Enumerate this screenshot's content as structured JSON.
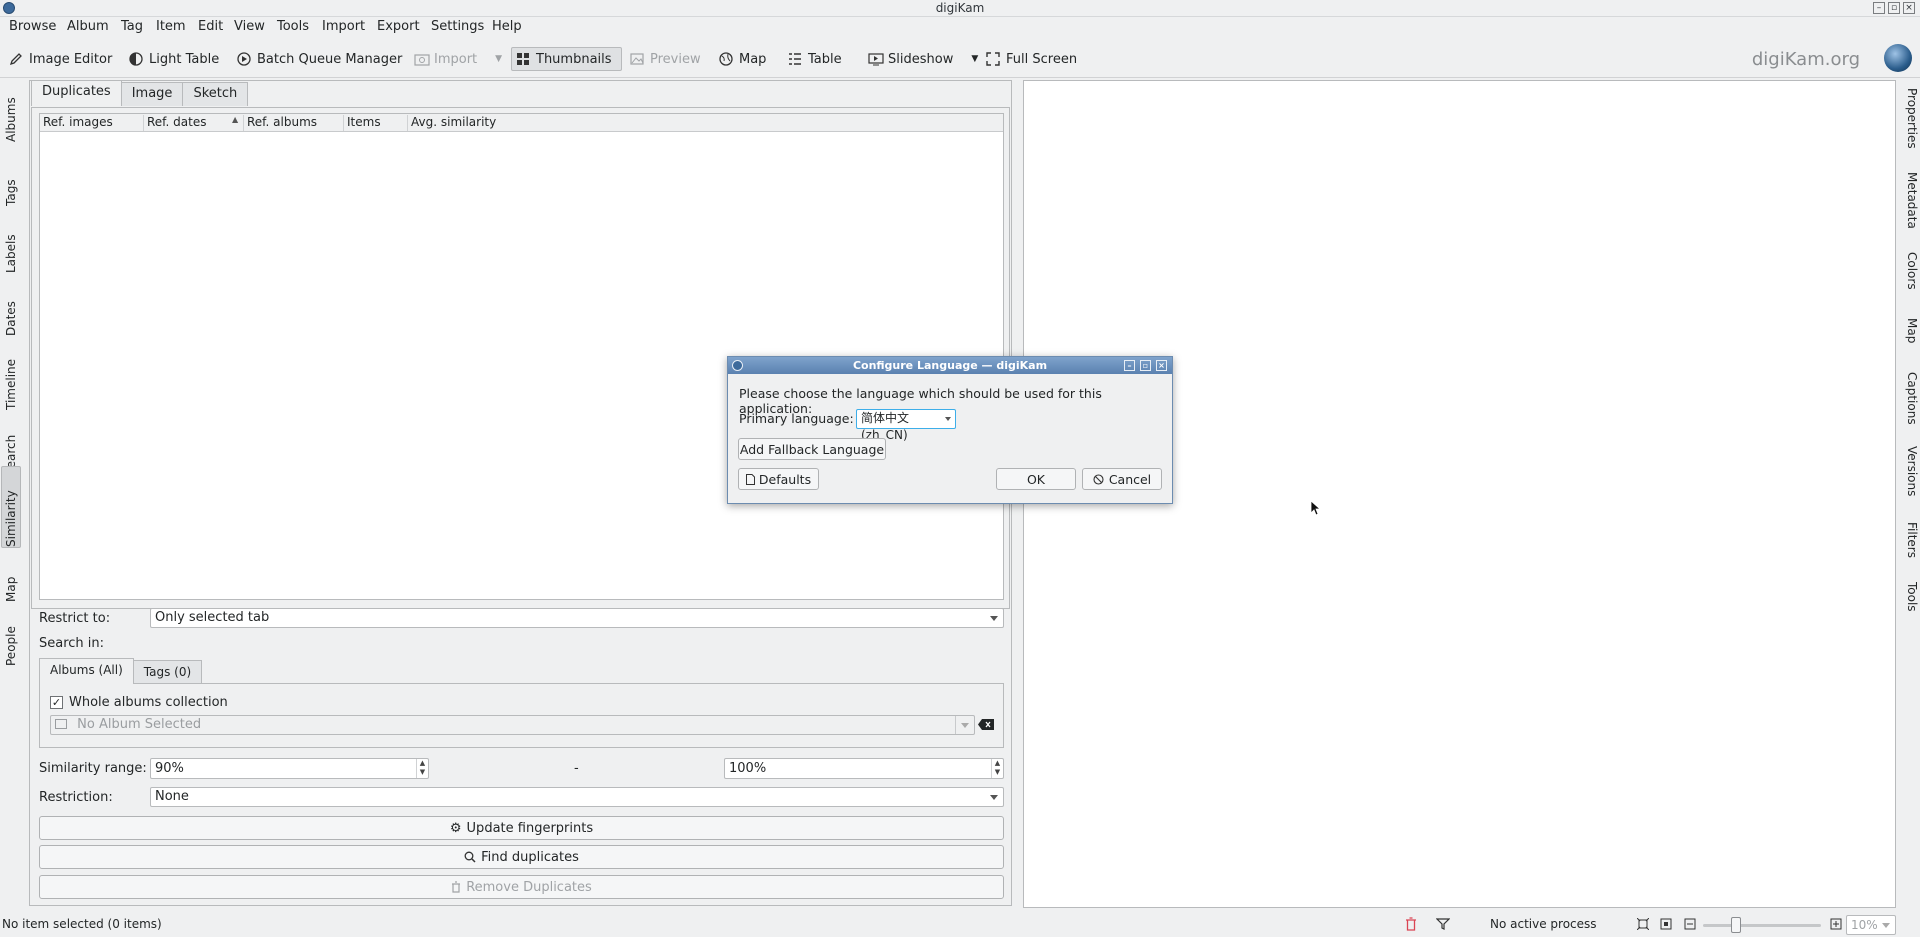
{
  "window": {
    "title": "digiKam"
  },
  "menubar": [
    "Browse",
    "Album",
    "Tag",
    "Item",
    "Edit",
    "View",
    "Tools",
    "Import",
    "Export",
    "Settings",
    "Help"
  ],
  "toolbar": {
    "image_editor": "Image Editor",
    "light_table": "Light Table",
    "batch_queue": "Batch Queue Manager",
    "import": "Import",
    "thumbnails": "Thumbnails",
    "preview": "Preview",
    "map": "Map",
    "table": "Table",
    "slideshow": "Slideshow",
    "full_screen": "Full Screen",
    "logo": "digiKam.org"
  },
  "left_sidebar": [
    "Albums",
    "Tags",
    "Labels",
    "Dates",
    "Timeline",
    "Search",
    "Similarity",
    "Map",
    "People"
  ],
  "right_sidebar": [
    "Properties",
    "Metadata",
    "Colors",
    "Map",
    "Captions",
    "Versions",
    "Filters",
    "Tools"
  ],
  "similarity": {
    "tabs": [
      "Duplicates",
      "Image",
      "Sketch"
    ],
    "columns": [
      "Ref. images",
      "Ref. dates",
      "Ref. albums",
      "Items",
      "Avg. similarity"
    ],
    "restrict_label": "Restrict to:",
    "restrict_value": "Only selected tab",
    "search_in_label": "Search in:",
    "search_tabs": [
      "Albums (All)",
      "Tags (0)"
    ],
    "whole_collection": "Whole albums collection",
    "album_placeholder": "No Album Selected",
    "range_label": "Similarity range:",
    "range_min": "90%",
    "range_sep": "-",
    "range_max": "100%",
    "restriction_label": "Restriction:",
    "restriction_value": "None",
    "update_btn": "Update fingerprints",
    "find_btn": "Find duplicates",
    "remove_btn": "Remove Duplicates"
  },
  "statusbar": {
    "left": "No item selected (0 items)",
    "process": "No active process",
    "zoom": "10%"
  },
  "dialog": {
    "title": "Configure Language — digiKam",
    "prompt": "Please choose the language which should be used for this application:",
    "primary_label": "Primary language:",
    "primary_value": "简体中文 (zh_CN)",
    "add_fallback": "Add Fallback Language",
    "defaults": "Defaults",
    "ok": "OK",
    "cancel": "Cancel"
  }
}
